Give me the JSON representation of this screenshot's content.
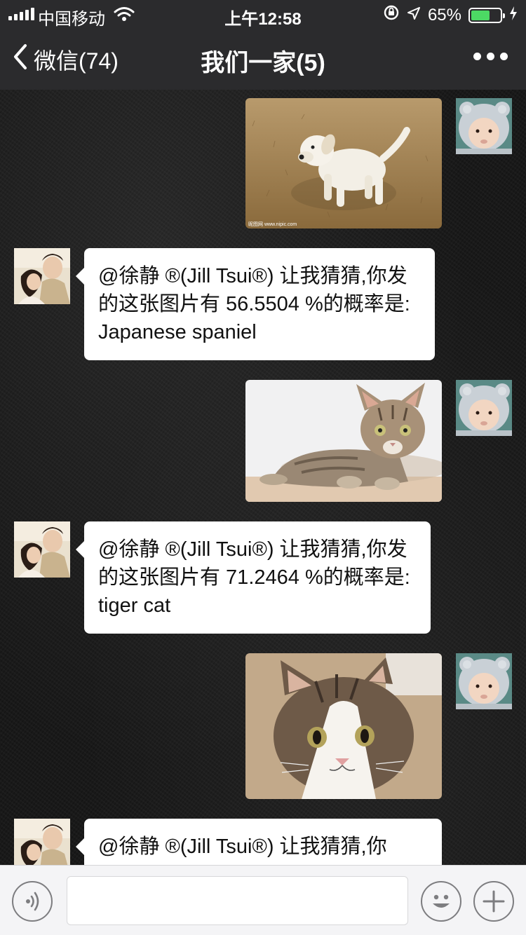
{
  "status_bar": {
    "carrier": "中国移动",
    "time": "上午12:58",
    "battery_percent": "65%",
    "battery_level": 0.65,
    "icons": [
      "signal-icon",
      "wifi-icon",
      "orientation-lock-icon",
      "location-icon",
      "battery-icon",
      "charging-icon"
    ]
  },
  "nav": {
    "back_label": "微信(74)",
    "title": "我们一家(5)",
    "more_icon": "more-dots-icon"
  },
  "messages": [
    {
      "type": "image",
      "side": "right",
      "content": "white puppy photo"
    },
    {
      "type": "text",
      "side": "left",
      "text": "@徐静 ®(Jill Tsui®) 让我猜猜,你发的这张图片有 56.5504 %的概率是: Japanese spaniel"
    },
    {
      "type": "image",
      "side": "right",
      "content": "tabby kitten photo"
    },
    {
      "type": "text",
      "side": "left",
      "text": "@徐静 ®(Jill Tsui®) 让我猜猜,你发的这张图片有 71.2464 %的概率是: tiger cat"
    },
    {
      "type": "image",
      "side": "right",
      "content": "tabby and white cat photo"
    },
    {
      "type": "text",
      "side": "left",
      "text": "@徐静 ®(Jill Tsui®) 让我猜猜,你"
    }
  ],
  "input": {
    "value": "",
    "placeholder": ""
  },
  "icons": {
    "voice": "voice-icon",
    "emoji": "emoji-icon",
    "plus": "plus-icon"
  },
  "colors": {
    "bar_background": "#2b2b2d",
    "bubble_background": "#ffffff",
    "battery_fill": "#4cd964",
    "input_bar_background": "#f4f4f6"
  }
}
